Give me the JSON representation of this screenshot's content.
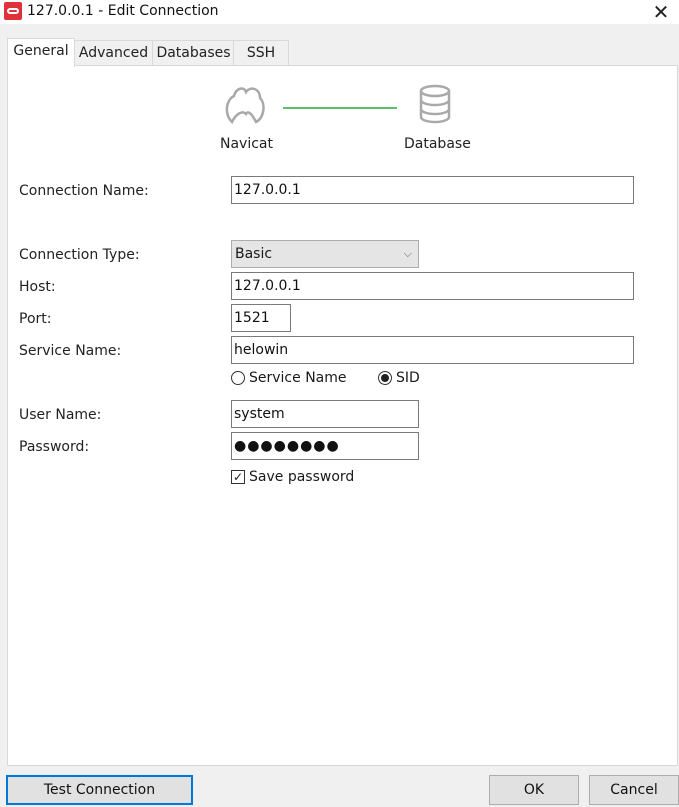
{
  "window": {
    "title": "127.0.0.1 - Edit Connection",
    "app_icon": "oracle-icon",
    "close_icon": "close-icon"
  },
  "tabs": [
    {
      "label": "General",
      "active": true
    },
    {
      "label": "Advanced",
      "active": false
    },
    {
      "label": "Databases",
      "active": false
    },
    {
      "label": "SSH",
      "active": false
    }
  ],
  "diagram": {
    "left_label": "Navicat",
    "right_label": "Database",
    "left_icon": "navicat-icon",
    "right_icon": "database-icon",
    "line_color": "#5cbf6a"
  },
  "form": {
    "connection_name": {
      "label": "Connection Name:",
      "value": "127.0.0.1"
    },
    "connection_type": {
      "label": "Connection Type:",
      "value": "Basic"
    },
    "host": {
      "label": "Host:",
      "value": "127.0.0.1"
    },
    "port": {
      "label": "Port:",
      "value": "1521"
    },
    "service_name": {
      "label": "Service Name:",
      "value": "helowin"
    },
    "service_type_options": [
      {
        "label": "Service Name",
        "selected": false
      },
      {
        "label": "SID",
        "selected": true
      }
    ],
    "user_name": {
      "label": "User Name:",
      "value": "system"
    },
    "password": {
      "label": "Password:",
      "value": "●●●●●●●●"
    },
    "save_password": {
      "label": "Save password",
      "checked": true
    }
  },
  "buttons": {
    "test": "Test Connection",
    "ok": "OK",
    "cancel": "Cancel"
  }
}
